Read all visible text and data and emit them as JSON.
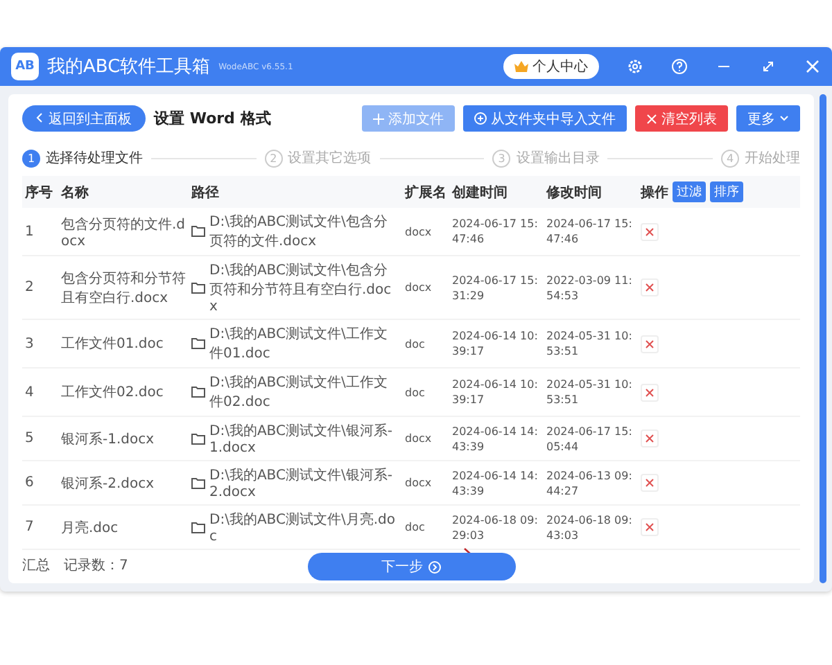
{
  "window": {
    "logo": "AB",
    "title": "我的ABC软件工具箱",
    "version": "WodeABC v6.55.1",
    "account_button": "个人中心"
  },
  "toolbar": {
    "back_button": "返回到主面板",
    "heading": "设置 Word 格式",
    "buttons": [
      {
        "label": "添加文件",
        "kind": "light"
      },
      {
        "label": "从文件夹中导入文件",
        "kind": "primary"
      },
      {
        "label": "清空列表",
        "kind": "danger"
      },
      {
        "label": "更多",
        "kind": "menu"
      }
    ]
  },
  "steps": [
    {
      "number": "1",
      "label": "选择待处理文件",
      "selected": true
    },
    {
      "number": "2",
      "label": "设置其它选项",
      "selected": false
    },
    {
      "number": "3",
      "label": "设置输出目录",
      "selected": false
    },
    {
      "number": "4",
      "label": "开始处理",
      "selected": false
    }
  ],
  "table": {
    "columns": [
      "序号",
      "名称",
      "路径",
      "扩展名",
      "创建时间",
      "修改时间",
      "操作"
    ],
    "header_buttons": [
      "过滤",
      "排序"
    ],
    "rows": [
      {
        "index": "1",
        "name": "包含分页符的文件.docx",
        "path": "D:\\我的ABC测试文件\\包含分页符的文件.docx",
        "ext": "docx",
        "created": "2024-06-17 15:47:46",
        "modified": "2024-06-17 15:47:46"
      },
      {
        "index": "2",
        "name": "包含分页符和分节符且有空白行.docx",
        "path": "D:\\我的ABC测试文件\\包含分页符和分节符且有空白行.docx",
        "ext": "docx",
        "created": "2024-06-17 15:31:29",
        "modified": "2022-03-09 11:54:53"
      },
      {
        "index": "3",
        "name": "工作文件01.doc",
        "path": "D:\\我的ABC测试文件\\工作文件01.doc",
        "ext": "doc",
        "created": "2024-06-14 10:39:17",
        "modified": "2024-05-31 10:53:51"
      },
      {
        "index": "4",
        "name": "工作文件02.doc",
        "path": "D:\\我的ABC测试文件\\工作文件02.doc",
        "ext": "doc",
        "created": "2024-06-14 10:39:17",
        "modified": "2024-05-31 10:53:51"
      },
      {
        "index": "5",
        "name": "银河系-1.docx",
        "path": "D:\\我的ABC测试文件\\银河系-1.docx",
        "ext": "docx",
        "created": "2024-06-14 14:43:39",
        "modified": "2024-06-17 15:05:44"
      },
      {
        "index": "6",
        "name": "银河系-2.docx",
        "path": "D:\\我的ABC测试文件\\银河系-2.docx",
        "ext": "docx",
        "created": "2024-06-14 14:43:39",
        "modified": "2024-06-13 09:44:27"
      },
      {
        "index": "7",
        "name": "月亮.doc",
        "path": "D:\\我的ABC测试文件\\月亮.doc",
        "ext": "doc",
        "created": "2024-06-18 09:29:03",
        "modified": "2024-06-18 09:43:03"
      }
    ]
  },
  "summary": {
    "label": "汇总",
    "count": "记录数：7"
  },
  "next_button": "下一步"
}
